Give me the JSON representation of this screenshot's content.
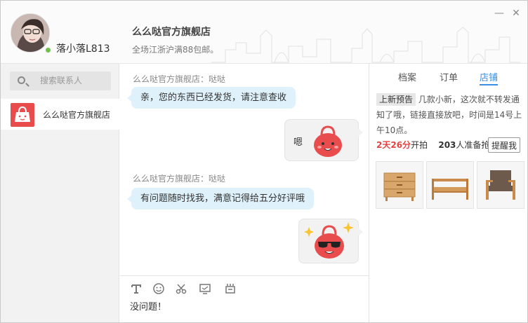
{
  "user": {
    "name": "落小落L813",
    "status": "online"
  },
  "shop": {
    "name": "么么哒官方旗舰店",
    "subtitle": "全场江浙沪满88包邮。"
  },
  "window_controls": {
    "minimize": "—",
    "close": "✕"
  },
  "search": {
    "placeholder": "搜索联系人"
  },
  "contacts": [
    {
      "name": "么么哒官方旗舰店",
      "icon": "red-bag-icon"
    }
  ],
  "messages": [
    {
      "sender": "么么哒官方旗舰店：哒哒",
      "text": "亲，您的东西已经发货，请注意查收"
    },
    {
      "from_me": true,
      "text": "嗯",
      "sticker": "red-bag-sticker"
    },
    {
      "sender": "么么哒官方旗舰店：哒哒",
      "text": "有问题随时找我，满意记得给五分好评哦"
    },
    {
      "from_me": true,
      "sticker": "red-bag-sunglasses-sticker"
    }
  ],
  "composer": {
    "tools": [
      "font-icon",
      "emoji-icon",
      "scissors-icon",
      "screenshot-icon",
      "history-icon"
    ],
    "text": "没问题！"
  },
  "right_panel": {
    "tabs": [
      "档案",
      "订单",
      "店铺"
    ],
    "active_tab": "店铺",
    "notice_badge": "上新预告",
    "notice_text": "几款小新，这次就不转发通知了哦，链接直接放吧，时间是14号上午10点。",
    "countdown_value": "2天26分",
    "countdown_suffix": "开拍",
    "waiting_count": "203",
    "waiting_suffix": "人准备抢",
    "remind_button": "提醒我",
    "products": [
      "wooden-cabinet",
      "wooden-bench",
      "armchair"
    ]
  },
  "colors": {
    "accent_blue": "#3a8ee6",
    "bubble_in": "#dff2fb",
    "brand_red": "#e84c4c",
    "countdown_red": "#e64340"
  }
}
